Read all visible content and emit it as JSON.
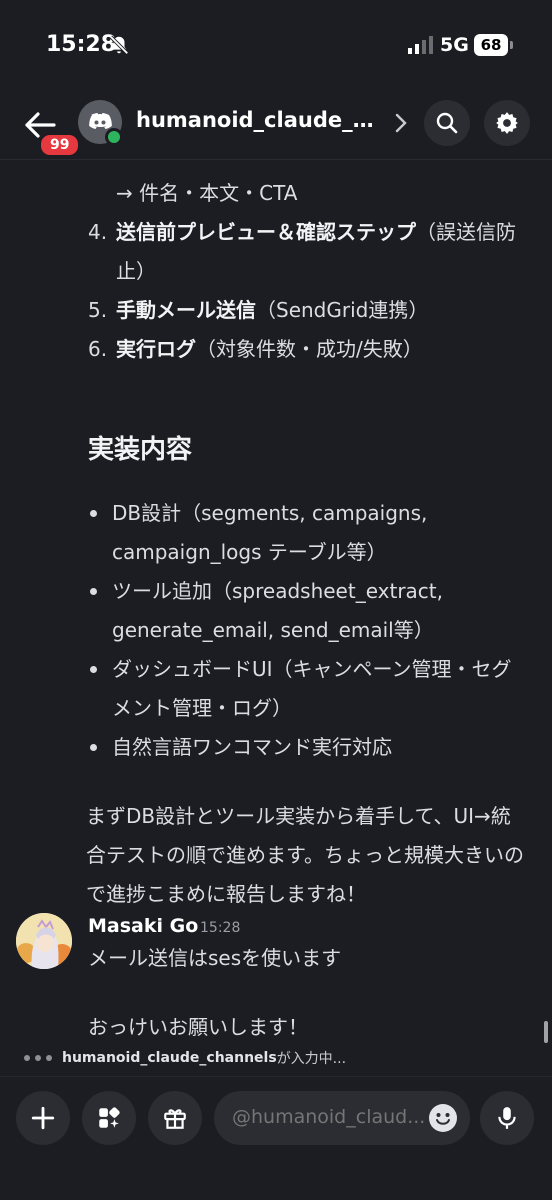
{
  "status_bar": {
    "time": "15:28",
    "network": "5G",
    "battery": "68"
  },
  "header": {
    "unread_count": "99",
    "channel_title": "humanoid_claude_c..."
  },
  "message_top": {
    "partial_line": "→ 件名・本文・CTA",
    "steps": [
      {
        "num": "4.",
        "bold": "送信前プレビュー＆確認ステップ",
        "rest": "（誤送信防止）"
      },
      {
        "num": "5.",
        "bold": "手動メール送信",
        "rest": "（SendGrid連携）"
      },
      {
        "num": "6.",
        "bold": "実行ログ",
        "rest": "（対象件数・成功/失敗）"
      }
    ],
    "section_heading": "実装内容",
    "bullets": [
      "DB設計（segments, campaigns, campaign_logs テーブル等）",
      "ツール追加（spreadsheet_extract, generate_email, send_email等）",
      "ダッシュボードUI（キャンペーン管理・セグメント管理・ログ）",
      "自然言語ワンコマンド実行対応"
    ],
    "closing": "まずDB設計とツール実装から着手して、UI→統合テストの順で進めます。ちょっと規模大きいので進捗こまめに報告しますね！"
  },
  "reply": {
    "username": "Masaki Go",
    "timestamp": "15:28",
    "lines": [
      "メール送信はsesを使います",
      "おっけいお願いします！"
    ]
  },
  "typing": {
    "name": "humanoid_claude_channels",
    "suffix": " が入力中..."
  },
  "composer": {
    "placeholder": "@humanoid_claud..."
  },
  "icons": [
    "back-arrow-icon",
    "discord-logo-icon",
    "chevron-right-icon",
    "search-icon",
    "gear-icon",
    "plus-icon",
    "apps-icon",
    "gift-icon",
    "emoji-icon",
    "microphone-icon"
  ],
  "colors": {
    "background": "#1c1d22",
    "badge": "#e5383f",
    "online": "#2db55d",
    "button": "#2b2d33"
  }
}
